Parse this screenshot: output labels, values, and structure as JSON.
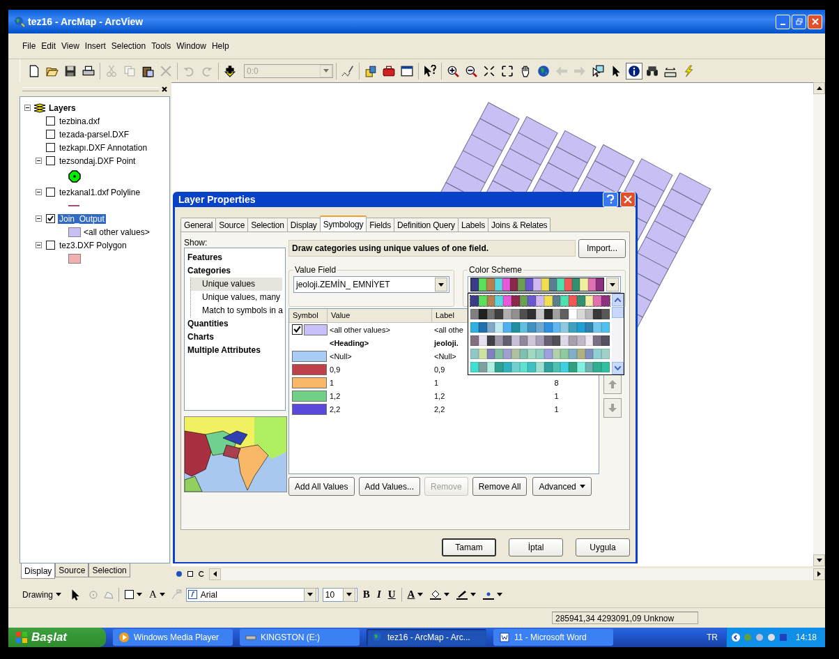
{
  "window": {
    "title": "tez16 - ArcMap - ArcView"
  },
  "menu": [
    "File",
    "Edit",
    "View",
    "Insert",
    "Selection",
    "Tools",
    "Window",
    "Help"
  ],
  "toolbar": [
    {
      "items": [
        {
          "kind": "new",
          "disabled": false,
          "selected": false
        },
        {
          "kind": "open",
          "disabled": false,
          "selected": false
        },
        {
          "kind": "save",
          "disabled": false,
          "selected": false
        },
        {
          "kind": "print",
          "disabled": false,
          "selected": false
        }
      ]
    },
    {
      "items": [
        {
          "kind": "cut",
          "disabled": true,
          "selected": false
        },
        {
          "kind": "copy",
          "disabled": true,
          "selected": false
        },
        {
          "kind": "paste",
          "disabled": false,
          "selected": false
        },
        {
          "kind": "delete",
          "disabled": true,
          "selected": false
        }
      ]
    },
    {
      "items": [
        {
          "kind": "undo",
          "disabled": true,
          "selected": false
        },
        {
          "kind": "redo",
          "disabled": true,
          "selected": false
        }
      ]
    },
    {
      "items": [
        {
          "kind": "add",
          "disabled": false,
          "selected": false
        },
        {
          "kind": "scale",
          "value": "0:0",
          "disabled": true
        }
      ]
    },
    {
      "items": [
        {
          "kind": "editor",
          "disabled": false,
          "selected": false
        }
      ]
    },
    {
      "items": [
        {
          "kind": "catalog",
          "disabled": false,
          "selected": false
        },
        {
          "kind": "toolbox",
          "disabled": false,
          "selected": false
        },
        {
          "kind": "command",
          "disabled": false,
          "selected": false
        }
      ]
    },
    {
      "items": [
        {
          "kind": "whats",
          "disabled": false,
          "selected": false
        }
      ]
    },
    {
      "items": [
        {
          "kind": "zoomin",
          "disabled": false,
          "selected": false
        },
        {
          "kind": "zoomout",
          "disabled": false,
          "selected": false
        },
        {
          "kind": "fixin",
          "disabled": false,
          "selected": false
        },
        {
          "kind": "fixout",
          "disabled": false,
          "selected": false
        },
        {
          "kind": "pan",
          "disabled": false,
          "selected": false
        },
        {
          "kind": "full",
          "disabled": false,
          "selected": false
        },
        {
          "kind": "back",
          "disabled": true,
          "selected": false
        },
        {
          "kind": "forward",
          "disabled": true,
          "selected": false
        },
        {
          "kind": "selel",
          "disabled": false,
          "selected": false
        },
        {
          "kind": "pointer",
          "disabled": false,
          "selected": false
        },
        {
          "kind": "identify",
          "disabled": false,
          "selected": true
        },
        {
          "kind": "find",
          "disabled": false,
          "selected": false
        },
        {
          "kind": "measure",
          "disabled": false,
          "selected": false
        },
        {
          "kind": "hyperlink",
          "disabled": false,
          "selected": false
        }
      ]
    }
  ],
  "toc": {
    "title": "Layers",
    "expanded": true,
    "layers": [
      {
        "name": "tezbina.dxf",
        "checked": false,
        "selected": false
      },
      {
        "name": "tezada-parsel.DXF",
        "checked": false,
        "selected": false
      },
      {
        "name": "tezkapı.DXF Annotation",
        "checked": false,
        "selected": false
      },
      {
        "name": "tezsondaj.DXF Point",
        "checked": false,
        "selected": false,
        "expanded": true,
        "legend": {
          "kind": "point",
          "color": "#00ee00"
        }
      },
      {
        "name": "tezkanal1.dxf Polyline",
        "checked": false,
        "selected": false,
        "expanded": true,
        "legend": {
          "kind": "line",
          "color": "#a05070"
        }
      },
      {
        "name": "Join_Output",
        "checked": true,
        "selected": true,
        "expanded": true,
        "legend": {
          "kind": "fill",
          "color": "#c8c0f4",
          "label": "<all other values>"
        }
      },
      {
        "name": "tez3.DXF Polygon",
        "checked": false,
        "selected": false,
        "expanded": true,
        "legend": {
          "kind": "fill",
          "color": "#f4b0b0"
        }
      }
    ]
  },
  "toc_tabs": [
    {
      "label": "Display",
      "selected": true
    },
    {
      "label": "Source",
      "selected": false
    },
    {
      "label": "Selection",
      "selected": false
    }
  ],
  "dialog": {
    "title": "Layer Properties",
    "tabs": [
      {
        "label": "General",
        "selected": false
      },
      {
        "label": "Source",
        "selected": false
      },
      {
        "label": "Selection",
        "selected": false
      },
      {
        "label": "Display",
        "selected": false
      },
      {
        "label": "Symbology",
        "selected": true
      },
      {
        "label": "Fields",
        "selected": false
      },
      {
        "label": "Definition Query",
        "selected": false
      },
      {
        "label": "Labels",
        "selected": false
      },
      {
        "label": "Joins & Relates",
        "selected": false
      }
    ],
    "show_label": "Show:",
    "show_tree": [
      {
        "label": "Features"
      },
      {
        "label": "Categories",
        "children": [
          {
            "label": "Unique values",
            "selected": true
          },
          {
            "label": "Unique values, many",
            "selected": false
          },
          {
            "label": "Match to symbols in a",
            "selected": false
          }
        ]
      },
      {
        "label": "Quantities"
      },
      {
        "label": "Charts"
      },
      {
        "label": "Multiple Attributes"
      }
    ],
    "description": "Draw categories using unique values of one field.",
    "import_button": "Import...",
    "value_field": {
      "label": "Value Field",
      "value": "jeoloji.ZEMİN_ EMNİYET"
    },
    "color_scheme": {
      "label": "Color Scheme",
      "expanded": true,
      "options": [
        {
          "selected": true,
          "colors": [
            {
              "color": "#3b3b8a"
            },
            {
              "color": "#5be05b"
            },
            {
              "color": "#b87f50"
            },
            {
              "color": "#5ad6e0"
            },
            {
              "color": "#e858d8"
            },
            {
              "color": "#8a2a4a"
            },
            {
              "color": "#6aa050"
            },
            {
              "color": "#6a58d0"
            },
            {
              "color": "#d0b8f0"
            },
            {
              "color": "#f0e050"
            },
            {
              "color": "#5a8090"
            },
            {
              "color": "#50e0b0"
            },
            {
              "color": "#f05858"
            },
            {
              "color": "#309070"
            },
            {
              "color": "#f0f0a0"
            },
            {
              "color": "#e070b0"
            },
            {
              "color": "#903080"
            }
          ]
        },
        {
          "selected": false,
          "colors": [
            {
              "color": "#808080"
            },
            {
              "color": "#202020"
            },
            {
              "color": "#707070"
            },
            {
              "color": "#404040"
            },
            {
              "color": "#b0b0b0"
            },
            {
              "color": "#909090"
            },
            {
              "color": "#505050"
            },
            {
              "color": "#303030"
            },
            {
              "color": "#c8c8c8"
            },
            {
              "color": "#282828"
            },
            {
              "color": "#a0a0a0"
            },
            {
              "color": "#606060"
            },
            {
              "color": "#ffffff"
            },
            {
              "color": "#d8d8d8"
            },
            {
              "color": "#b8b8b8"
            },
            {
              "color": "#383838"
            },
            {
              "color": "#585858"
            }
          ]
        },
        {
          "selected": false,
          "colors": [
            {
              "color": "#30b0e0"
            },
            {
              "color": "#2070b0"
            },
            {
              "color": "#80a8c8"
            },
            {
              "color": "#c0e8f0"
            },
            {
              "color": "#50b0f0"
            },
            {
              "color": "#2090a0"
            },
            {
              "color": "#60c0e0"
            },
            {
              "color": "#4090c0"
            },
            {
              "color": "#70a8d0"
            },
            {
              "color": "#3090e0"
            },
            {
              "color": "#60b8f0"
            },
            {
              "color": "#90c8e0"
            },
            {
              "color": "#40a0c0"
            },
            {
              "color": "#20a0d0"
            },
            {
              "color": "#3080b0"
            },
            {
              "color": "#70c8f0"
            },
            {
              "color": "#50c0f0"
            }
          ]
        },
        {
          "selected": false,
          "colors": [
            {
              "color": "#807080"
            },
            {
              "color": "#e8e0f0"
            },
            {
              "color": "#404048"
            },
            {
              "color": "#a098a8"
            },
            {
              "color": "#606070"
            },
            {
              "color": "#c8c0d8"
            },
            {
              "color": "#908898"
            },
            {
              "color": "#d0c8d8"
            },
            {
              "color": "#a8a0b8"
            },
            {
              "color": "#686070"
            },
            {
              "color": "#505058"
            },
            {
              "color": "#e0d8e8"
            },
            {
              "color": "#a8a0a8"
            },
            {
              "color": "#c0b8c8"
            },
            {
              "color": "#f0e8f0"
            },
            {
              "color": "#787080"
            },
            {
              "color": "#585060"
            }
          ]
        },
        {
          "selected": false,
          "colors": [
            {
              "color": "#90c8c8"
            },
            {
              "color": "#d0e0a0"
            },
            {
              "color": "#8080c0"
            },
            {
              "color": "#80c0a0"
            },
            {
              "color": "#a0a0d0"
            },
            {
              "color": "#b0c0a0"
            },
            {
              "color": "#80c0b0"
            },
            {
              "color": "#a0d8c0"
            },
            {
              "color": "#90d0c0"
            },
            {
              "color": "#a0a0e0"
            },
            {
              "color": "#b0d0b0"
            },
            {
              "color": "#90c8a0"
            },
            {
              "color": "#80b0c8"
            },
            {
              "color": "#b0b080"
            },
            {
              "color": "#8090c0"
            },
            {
              "color": "#90d0d0"
            },
            {
              "color": "#a0d0c8"
            }
          ]
        },
        {
          "selected": false,
          "colors": [
            {
              "color": "#40e0d0"
            },
            {
              "color": "#80a0a0"
            },
            {
              "color": "#b0f0e0"
            },
            {
              "color": "#30a090"
            },
            {
              "color": "#30b0c0"
            },
            {
              "color": "#70d0d0"
            },
            {
              "color": "#60e0d0"
            },
            {
              "color": "#40c0c0"
            },
            {
              "color": "#a0e0d0"
            },
            {
              "color": "#30a0a0"
            },
            {
              "color": "#50c0b0"
            },
            {
              "color": "#40d0e0"
            },
            {
              "color": "#30a080"
            },
            {
              "color": "#80f0e0"
            },
            {
              "color": "#70b0b0"
            },
            {
              "color": "#30b090"
            },
            {
              "color": "#30c0a0"
            }
          ]
        }
      ]
    },
    "table": {
      "columns": [
        "Symbol",
        "Value",
        "Label"
      ],
      "rows": [
        {
          "kind": "other",
          "checked": true,
          "color": "#c8c0f8",
          "value": "<all other values>",
          "label": "<all othe"
        },
        {
          "kind": "heading",
          "value": "<Heading>",
          "label": "jeoloji."
        },
        {
          "kind": "value",
          "color": "#a8ccf4",
          "value": "<Null>",
          "label": "<Null>"
        },
        {
          "kind": "value",
          "color": "#c0404a",
          "value": "0,9",
          "label": "0,9"
        },
        {
          "kind": "value",
          "color": "#f8b868",
          "value": "1",
          "label": "1",
          "count": "8"
        },
        {
          "kind": "value",
          "color": "#70d088",
          "value": "1,2",
          "label": "1,2",
          "count": "1"
        },
        {
          "kind": "value",
          "color": "#5a48d8",
          "value": "2,2",
          "label": "2,2",
          "count": "1"
        }
      ]
    },
    "move_buttons": [
      {
        "kind": "up",
        "disabled": true
      },
      {
        "kind": "down",
        "disabled": true
      }
    ],
    "buttons": [
      {
        "label": "Add All Values",
        "disabled": false
      },
      {
        "label": "Add Values...",
        "disabled": false
      },
      {
        "label": "Remove",
        "disabled": true
      },
      {
        "label": "Remove All",
        "disabled": false
      }
    ],
    "advanced": "Advanced",
    "footer_buttons": [
      {
        "label": "Tamam",
        "default": true
      },
      {
        "label": "İptal",
        "default": false
      },
      {
        "label": "Uygula",
        "default": false
      }
    ]
  },
  "drawing_toolbar": {
    "menu": "Drawing",
    "text_tool": "A",
    "font": "Arial",
    "size": "10",
    "styles": [
      "B",
      "I",
      "U"
    ],
    "font_color": "A"
  },
  "status": {
    "coordinates": "285941,34  4293091,09 Unknow"
  },
  "taskbar": {
    "start": "Başlat",
    "tasks": [
      {
        "kind": "media",
        "label": "Windows Media Player",
        "selected": false
      },
      {
        "kind": "drive",
        "label": "KINGSTON (E:)",
        "selected": false
      },
      {
        "kind": "globe",
        "label": "tez16 - ArcMap - Arc...",
        "selected": true
      },
      {
        "kind": "word",
        "label": "11 - Microsoft Word",
        "selected": false
      }
    ],
    "language": "TR",
    "clock": "14:18"
  }
}
